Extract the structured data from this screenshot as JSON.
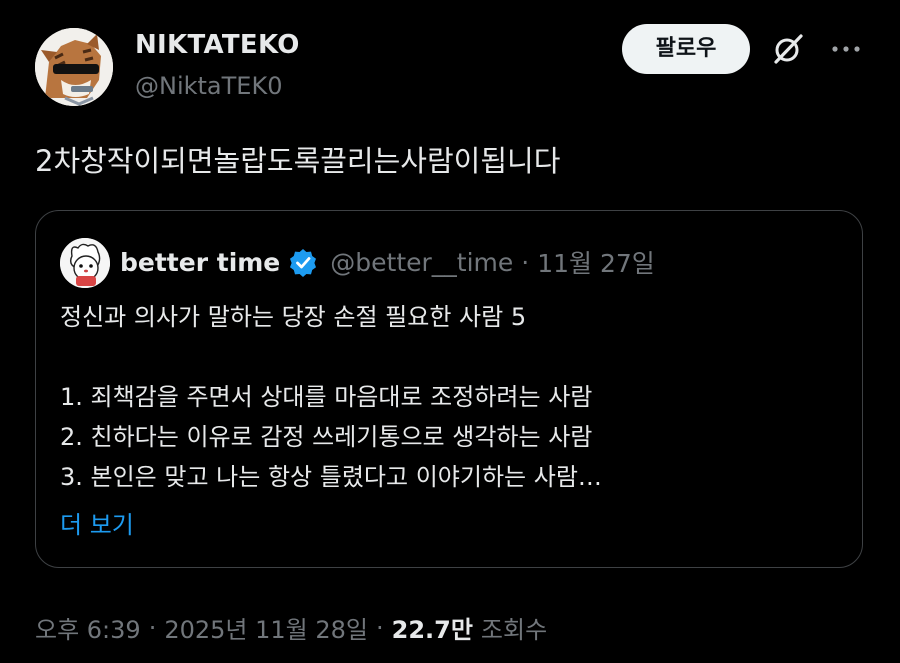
{
  "post": {
    "author": {
      "name": "NIKTATEKO",
      "handle": "@NiktaTEK0"
    },
    "follow_label": "팔로우",
    "text": "2차창작이되면놀랍도록끌리는사람이됩니다"
  },
  "quote": {
    "author": {
      "name": "better time",
      "handle": "@better__time"
    },
    "separator": "·",
    "date": "11월 27일",
    "lines": [
      "정신과 의사가 말하는 당장 손절 필요한 사람 5",
      "",
      "1. 죄책감을 주면서 상대를 마음대로 조정하려는 사람",
      "2. 친하다는 이유로 감정 쓰레기통으로 생각하는 사람",
      "3. 본인은 맞고 나는 항상 틀렸다고 이야기하는 사람…"
    ],
    "show_more": "더 보기"
  },
  "meta": {
    "time": "오후 6:39",
    "separator": "·",
    "date": "2025년 11월 28일",
    "views_count": "22.7만",
    "views_label": "조회수"
  },
  "colors": {
    "background": "#000000",
    "primary_text": "#e7e9ea",
    "secondary_text": "#71767b",
    "link": "#1d9bf0",
    "verified": "#1d9bf0",
    "border": "#3e4144"
  },
  "icons": {
    "grok": "grok-icon",
    "more": "more-icon",
    "verified": "verified-badge-icon"
  }
}
